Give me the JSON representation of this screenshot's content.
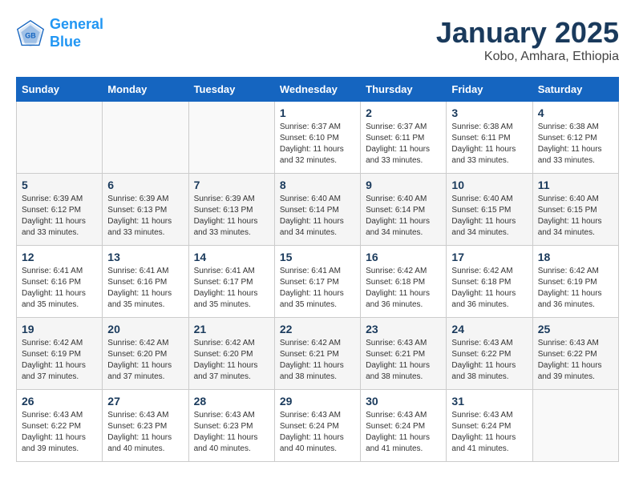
{
  "logo": {
    "line1": "General",
    "line2": "Blue"
  },
  "title": "January 2025",
  "subtitle": "Kobo, Amhara, Ethiopia",
  "days_of_week": [
    "Sunday",
    "Monday",
    "Tuesday",
    "Wednesday",
    "Thursday",
    "Friday",
    "Saturday"
  ],
  "weeks": [
    [
      {
        "day": "",
        "sunrise": "",
        "sunset": "",
        "daylight": ""
      },
      {
        "day": "",
        "sunrise": "",
        "sunset": "",
        "daylight": ""
      },
      {
        "day": "",
        "sunrise": "",
        "sunset": "",
        "daylight": ""
      },
      {
        "day": "1",
        "sunrise": "Sunrise: 6:37 AM",
        "sunset": "Sunset: 6:10 PM",
        "daylight": "Daylight: 11 hours and 32 minutes."
      },
      {
        "day": "2",
        "sunrise": "Sunrise: 6:37 AM",
        "sunset": "Sunset: 6:11 PM",
        "daylight": "Daylight: 11 hours and 33 minutes."
      },
      {
        "day": "3",
        "sunrise": "Sunrise: 6:38 AM",
        "sunset": "Sunset: 6:11 PM",
        "daylight": "Daylight: 11 hours and 33 minutes."
      },
      {
        "day": "4",
        "sunrise": "Sunrise: 6:38 AM",
        "sunset": "Sunset: 6:12 PM",
        "daylight": "Daylight: 11 hours and 33 minutes."
      }
    ],
    [
      {
        "day": "5",
        "sunrise": "Sunrise: 6:39 AM",
        "sunset": "Sunset: 6:12 PM",
        "daylight": "Daylight: 11 hours and 33 minutes."
      },
      {
        "day": "6",
        "sunrise": "Sunrise: 6:39 AM",
        "sunset": "Sunset: 6:13 PM",
        "daylight": "Daylight: 11 hours and 33 minutes."
      },
      {
        "day": "7",
        "sunrise": "Sunrise: 6:39 AM",
        "sunset": "Sunset: 6:13 PM",
        "daylight": "Daylight: 11 hours and 33 minutes."
      },
      {
        "day": "8",
        "sunrise": "Sunrise: 6:40 AM",
        "sunset": "Sunset: 6:14 PM",
        "daylight": "Daylight: 11 hours and 34 minutes."
      },
      {
        "day": "9",
        "sunrise": "Sunrise: 6:40 AM",
        "sunset": "Sunset: 6:14 PM",
        "daylight": "Daylight: 11 hours and 34 minutes."
      },
      {
        "day": "10",
        "sunrise": "Sunrise: 6:40 AM",
        "sunset": "Sunset: 6:15 PM",
        "daylight": "Daylight: 11 hours and 34 minutes."
      },
      {
        "day": "11",
        "sunrise": "Sunrise: 6:40 AM",
        "sunset": "Sunset: 6:15 PM",
        "daylight": "Daylight: 11 hours and 34 minutes."
      }
    ],
    [
      {
        "day": "12",
        "sunrise": "Sunrise: 6:41 AM",
        "sunset": "Sunset: 6:16 PM",
        "daylight": "Daylight: 11 hours and 35 minutes."
      },
      {
        "day": "13",
        "sunrise": "Sunrise: 6:41 AM",
        "sunset": "Sunset: 6:16 PM",
        "daylight": "Daylight: 11 hours and 35 minutes."
      },
      {
        "day": "14",
        "sunrise": "Sunrise: 6:41 AM",
        "sunset": "Sunset: 6:17 PM",
        "daylight": "Daylight: 11 hours and 35 minutes."
      },
      {
        "day": "15",
        "sunrise": "Sunrise: 6:41 AM",
        "sunset": "Sunset: 6:17 PM",
        "daylight": "Daylight: 11 hours and 35 minutes."
      },
      {
        "day": "16",
        "sunrise": "Sunrise: 6:42 AM",
        "sunset": "Sunset: 6:18 PM",
        "daylight": "Daylight: 11 hours and 36 minutes."
      },
      {
        "day": "17",
        "sunrise": "Sunrise: 6:42 AM",
        "sunset": "Sunset: 6:18 PM",
        "daylight": "Daylight: 11 hours and 36 minutes."
      },
      {
        "day": "18",
        "sunrise": "Sunrise: 6:42 AM",
        "sunset": "Sunset: 6:19 PM",
        "daylight": "Daylight: 11 hours and 36 minutes."
      }
    ],
    [
      {
        "day": "19",
        "sunrise": "Sunrise: 6:42 AM",
        "sunset": "Sunset: 6:19 PM",
        "daylight": "Daylight: 11 hours and 37 minutes."
      },
      {
        "day": "20",
        "sunrise": "Sunrise: 6:42 AM",
        "sunset": "Sunset: 6:20 PM",
        "daylight": "Daylight: 11 hours and 37 minutes."
      },
      {
        "day": "21",
        "sunrise": "Sunrise: 6:42 AM",
        "sunset": "Sunset: 6:20 PM",
        "daylight": "Daylight: 11 hours and 37 minutes."
      },
      {
        "day": "22",
        "sunrise": "Sunrise: 6:42 AM",
        "sunset": "Sunset: 6:21 PM",
        "daylight": "Daylight: 11 hours and 38 minutes."
      },
      {
        "day": "23",
        "sunrise": "Sunrise: 6:43 AM",
        "sunset": "Sunset: 6:21 PM",
        "daylight": "Daylight: 11 hours and 38 minutes."
      },
      {
        "day": "24",
        "sunrise": "Sunrise: 6:43 AM",
        "sunset": "Sunset: 6:22 PM",
        "daylight": "Daylight: 11 hours and 38 minutes."
      },
      {
        "day": "25",
        "sunrise": "Sunrise: 6:43 AM",
        "sunset": "Sunset: 6:22 PM",
        "daylight": "Daylight: 11 hours and 39 minutes."
      }
    ],
    [
      {
        "day": "26",
        "sunrise": "Sunrise: 6:43 AM",
        "sunset": "Sunset: 6:22 PM",
        "daylight": "Daylight: 11 hours and 39 minutes."
      },
      {
        "day": "27",
        "sunrise": "Sunrise: 6:43 AM",
        "sunset": "Sunset: 6:23 PM",
        "daylight": "Daylight: 11 hours and 40 minutes."
      },
      {
        "day": "28",
        "sunrise": "Sunrise: 6:43 AM",
        "sunset": "Sunset: 6:23 PM",
        "daylight": "Daylight: 11 hours and 40 minutes."
      },
      {
        "day": "29",
        "sunrise": "Sunrise: 6:43 AM",
        "sunset": "Sunset: 6:24 PM",
        "daylight": "Daylight: 11 hours and 40 minutes."
      },
      {
        "day": "30",
        "sunrise": "Sunrise: 6:43 AM",
        "sunset": "Sunset: 6:24 PM",
        "daylight": "Daylight: 11 hours and 41 minutes."
      },
      {
        "day": "31",
        "sunrise": "Sunrise: 6:43 AM",
        "sunset": "Sunset: 6:24 PM",
        "daylight": "Daylight: 11 hours and 41 minutes."
      },
      {
        "day": "",
        "sunrise": "",
        "sunset": "",
        "daylight": ""
      }
    ]
  ]
}
